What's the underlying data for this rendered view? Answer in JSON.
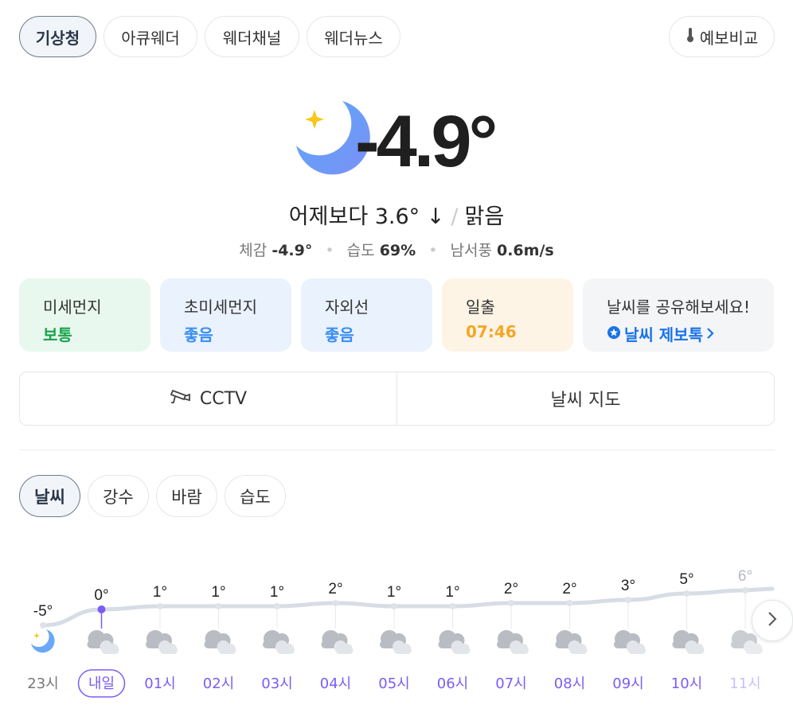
{
  "sources": {
    "tabs": [
      {
        "label": "기상청",
        "active": true
      },
      {
        "label": "아큐웨더",
        "active": false
      },
      {
        "label": "웨더채널",
        "active": false
      },
      {
        "label": "웨더뉴스",
        "active": false
      }
    ],
    "compare_label": "예보비교"
  },
  "current": {
    "icon": "moon-clear-icon",
    "temperature": "-4.9°",
    "vs_yesterday": "어제보다 3.6° ↓",
    "condition": "맑음",
    "feels_like_label": "체감",
    "feels_like": "-4.9°",
    "humidity_label": "습도",
    "humidity": "69%",
    "wind_label": "남서풍",
    "wind": "0.6m/s"
  },
  "cards": [
    {
      "label": "미세먼지",
      "value": "보통",
      "color": "#1aa34a",
      "bg": "#e8f8ee"
    },
    {
      "label": "초미세먼지",
      "value": "좋음",
      "color": "#3a8ef0",
      "bg": "#eaf2fe"
    },
    {
      "label": "자외선",
      "value": "좋음",
      "color": "#3a8ef0",
      "bg": "#eaf2fe"
    },
    {
      "label": "일출",
      "value": "07:46",
      "color": "#f5a623",
      "bg": "#fef4e6"
    },
    {
      "label": "날씨를 공유해보세요!",
      "value": "날씨 제보톡",
      "color": "#1a73e8",
      "bg": "#f4f5f7"
    }
  ],
  "buttons": {
    "cctv": "CCTV",
    "map": "날씨 지도"
  },
  "chart_tabs": [
    {
      "label": "날씨",
      "active": true
    },
    {
      "label": "강수",
      "active": false
    },
    {
      "label": "바람",
      "active": false
    },
    {
      "label": "습도",
      "active": false
    }
  ],
  "chart_data": {
    "type": "line",
    "x": [
      "23시",
      "내일",
      "01시",
      "02시",
      "03시",
      "04시",
      "05시",
      "06시",
      "07시",
      "08시",
      "09시",
      "10시",
      "11시"
    ],
    "values": [
      -5,
      0,
      1,
      1,
      1,
      2,
      1,
      1,
      2,
      2,
      3,
      5,
      6
    ],
    "labels": [
      "-5°",
      "0°",
      "1°",
      "1°",
      "1°",
      "2°",
      "1°",
      "1°",
      "2°",
      "2°",
      "3°",
      "5°",
      "6°"
    ],
    "icons": [
      "moon-clear-icon",
      "cloudy-icon",
      "cloudy-icon",
      "cloudy-icon",
      "cloudy-icon",
      "cloudy-icon",
      "cloudy-icon",
      "cloudy-icon",
      "cloudy-icon",
      "cloudy-icon",
      "cloudy-icon",
      "cloudy-icon",
      "cloudy-icon"
    ],
    "highlight_index": 1,
    "accent": "#7b5cf5"
  }
}
